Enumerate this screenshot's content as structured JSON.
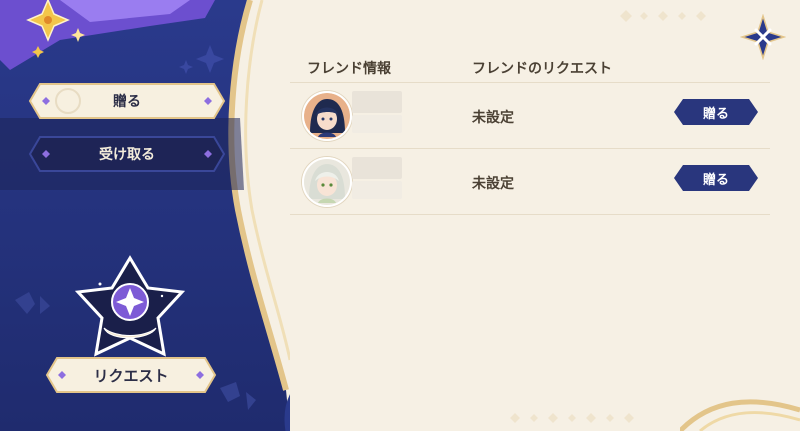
{
  "sidebar": {
    "tabs": [
      {
        "label": "贈る",
        "active": true
      },
      {
        "label": "受け取る",
        "active": false
      }
    ],
    "request_button": {
      "label": "リクエスト"
    }
  },
  "list": {
    "headers": {
      "friend_info": "フレンド情報",
      "friend_request": "フレンドのリクエスト"
    },
    "rows": [
      {
        "avatar": "dark-haired-character-avatar",
        "status": "未設定",
        "action": "贈る"
      },
      {
        "avatar": "white-haired-character-avatar",
        "status": "未設定",
        "action": "贈る"
      }
    ]
  },
  "colors": {
    "panel_navy": "#24317a",
    "panel_dark": "#1e2456",
    "cream": "#f6f0e4",
    "gold": "#e3c58a",
    "button_navy": "#29367d",
    "text_brown": "#4b4134",
    "accent_purple": "#8d6ee0"
  }
}
